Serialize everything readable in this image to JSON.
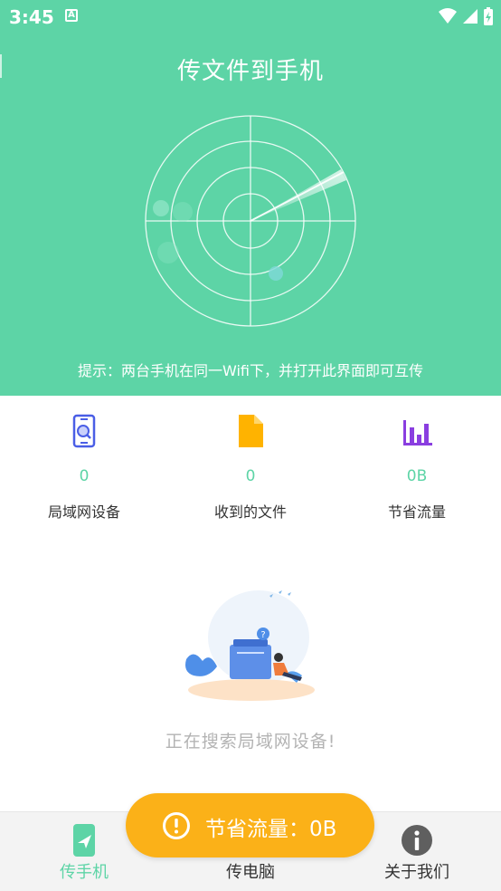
{
  "status_bar": {
    "time": "3:45",
    "notification_letter": "A"
  },
  "header": {
    "title": "传文件到手机",
    "hint": "提示：两台手机在同一Wifi下，并打开此界面即可互传"
  },
  "stats": [
    {
      "value": "0",
      "label": "局域网设备",
      "icon": "phone-search-icon",
      "color": "#4a5ee6"
    },
    {
      "value": "0",
      "label": "收到的文件",
      "icon": "file-icon",
      "color": "#ffb300"
    },
    {
      "value": "0B",
      "label": "节省流量",
      "icon": "bar-chart-icon",
      "color": "#8a3ee0"
    }
  ],
  "empty_state": {
    "message": "正在搜索局域网设备!"
  },
  "toast": {
    "text": "节省流量：0B",
    "icon": "exclamation-circle-icon",
    "color": "#fbb118"
  },
  "bottom_nav": [
    {
      "label": "传手机",
      "icon": "send-phone-icon",
      "active": true
    },
    {
      "label": "传电脑",
      "icon": "laptop-icon",
      "active": false
    },
    {
      "label": "关于我们",
      "icon": "info-icon",
      "active": false
    }
  ],
  "colors": {
    "accent": "#5dd4a6",
    "text": "#333333",
    "muted": "#b3b3b3"
  }
}
